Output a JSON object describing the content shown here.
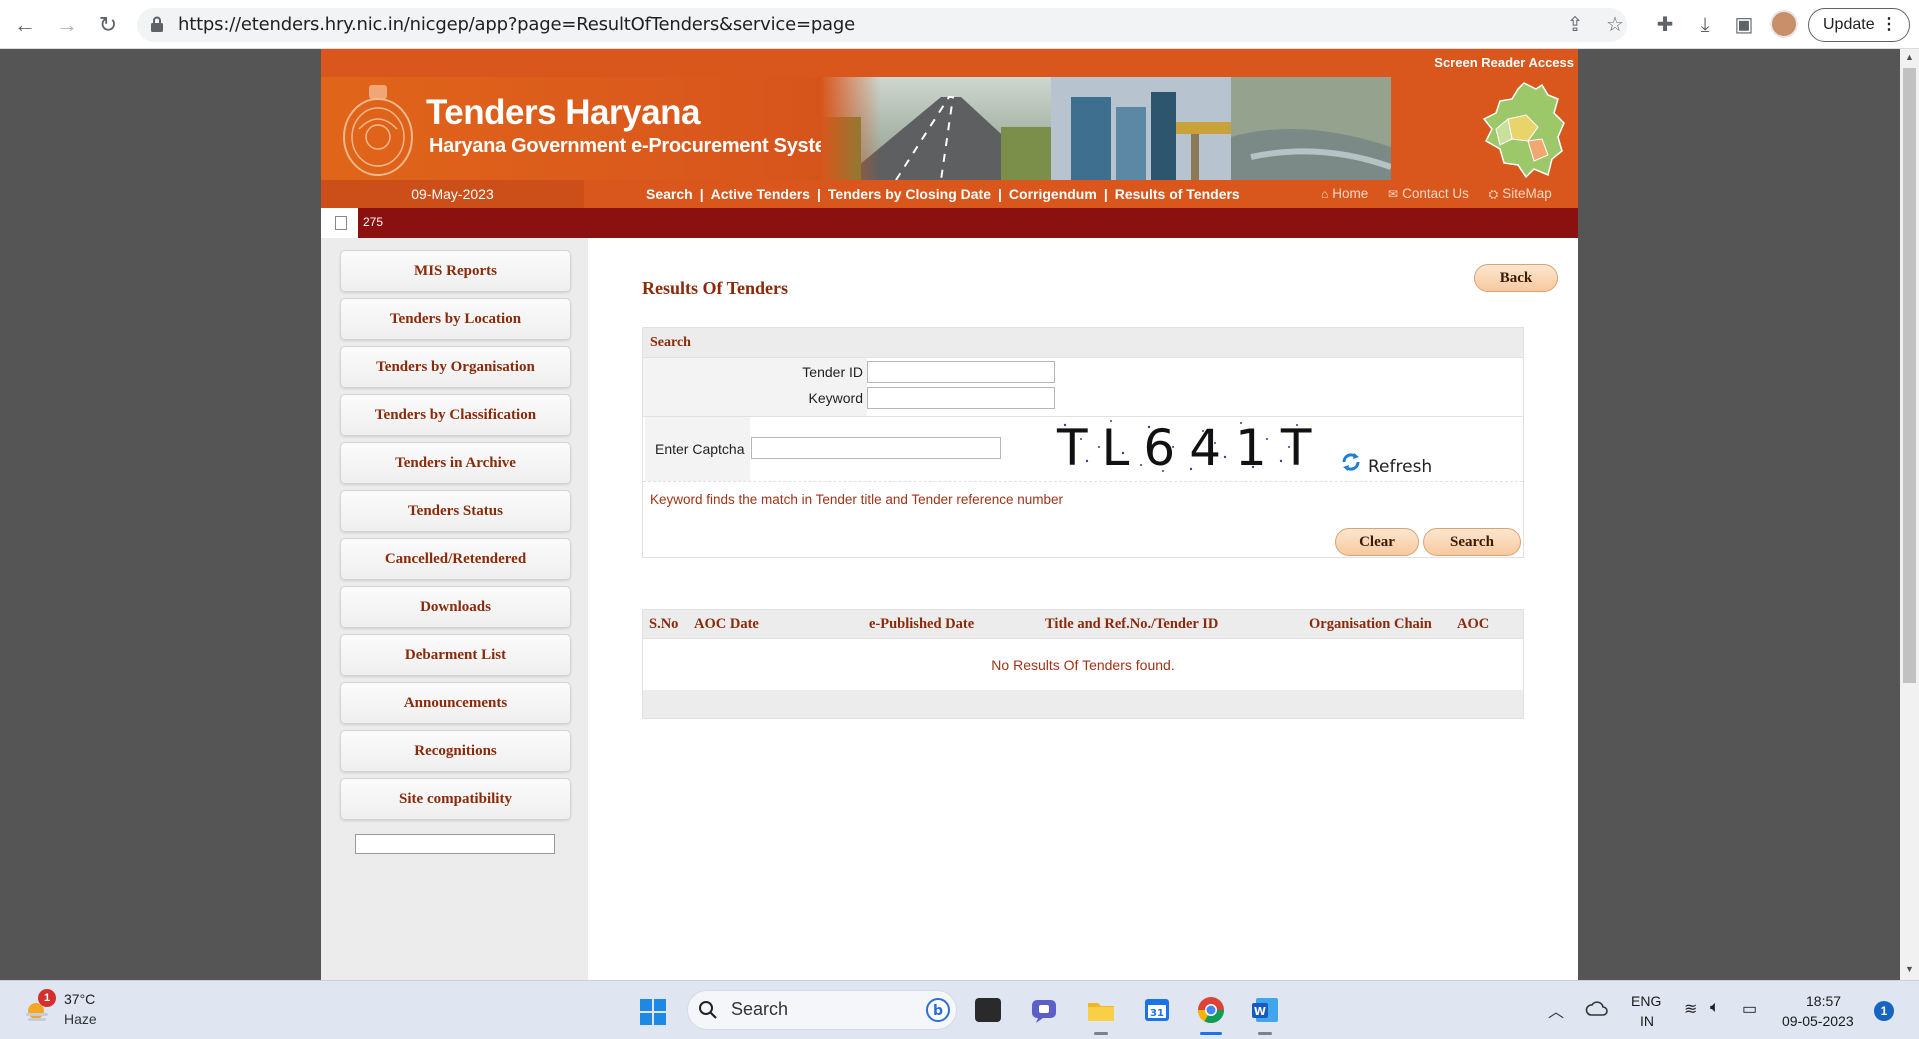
{
  "browser": {
    "url": "https://etenders.hry.nic.in/nicgep/app?page=ResultOfTenders&service=page",
    "update_label": "Update"
  },
  "site": {
    "screen_reader": "Screen Reader Access",
    "title": "Tenders Haryana",
    "subtitle": "Haryana Government e-Procurement System",
    "date": "09-May-2023",
    "nav_links": [
      "Search",
      "Active Tenders",
      "Tenders by Closing Date",
      "Corrigendum",
      "Results of Tenders"
    ],
    "nav_separator": "|",
    "nav_right": [
      "Home",
      "Contact Us",
      "SiteMap"
    ],
    "marquee_text": "275"
  },
  "sidebar": {
    "items": [
      "MIS Reports",
      "Tenders by Location",
      "Tenders by Organisation",
      "Tenders by Classification",
      "Tenders in Archive",
      "Tenders Status",
      "Cancelled/Retendered",
      "Downloads",
      "Debarment List",
      "Announcements",
      "Recognitions",
      "Site compatibility"
    ]
  },
  "main": {
    "title": "Results Of Tenders",
    "back_label": "Back",
    "search": {
      "heading": "Search",
      "tender_id_label": "Tender ID",
      "tender_id_value": "",
      "keyword_label": "Keyword",
      "keyword_value": "",
      "captcha_label": "Enter Captcha",
      "captcha_value": "",
      "captcha_text": "TL641T",
      "refresh_label": "Refresh",
      "hint": "Keyword finds the match in Tender title and Tender reference number",
      "clear_label": "Clear",
      "search_label": "Search"
    },
    "table": {
      "columns": [
        "S.No",
        "AOC Date",
        "e-Published Date",
        "Title and Ref.No./Tender ID",
        "Organisation Chain",
        "AOC"
      ],
      "empty_message": "No Results Of Tenders found."
    }
  },
  "taskbar": {
    "weather_badge": "1",
    "temperature": "37°C",
    "condition": "Haze",
    "search_placeholder": "Search",
    "calendar_day": "31",
    "lang_line1": "ENG",
    "lang_line2": "IN",
    "time": "18:57",
    "date": "09-05-2023",
    "notification_count": "1"
  },
  "colors": {
    "brand_orange": "#d9561c",
    "marquee_red": "#8b1010",
    "link_brown": "#8a2a0a"
  }
}
